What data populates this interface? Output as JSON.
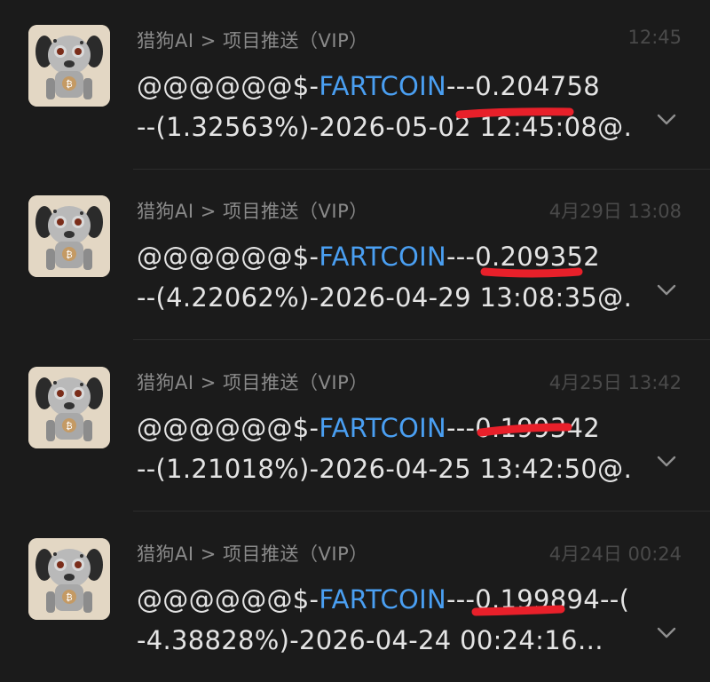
{
  "colors": {
    "background": "#1b1b1b",
    "sender": "#8a8a8a",
    "time": "#4a4a4a",
    "message": "#e4e4e4",
    "coin": "#4a9ff2",
    "annotation": "#e8202a"
  },
  "notifications": [
    {
      "sender": "猎狗AI > 项目推送（VIP）",
      "time": "12:45",
      "prefix": "@@@@@@$-",
      "coin": "FARTCOIN",
      "dashes": "---",
      "price": "0.204758",
      "line2": "--(1.32563%)-2026-05-02 12:45:08@…",
      "avatar_icon": "robot-dog-avatar",
      "expand_icon": "chevron-down-icon"
    },
    {
      "sender": "猎狗AI > 项目推送（VIP）",
      "time": "4月29日 13:08",
      "prefix": "@@@@@@$-",
      "coin": "FARTCOIN",
      "dashes": "---",
      "price": "0.209352",
      "line2": "--(4.22062%)-2026-04-29 13:08:35@…",
      "avatar_icon": "robot-dog-avatar",
      "expand_icon": "chevron-down-icon"
    },
    {
      "sender": "猎狗AI > 项目推送（VIP）",
      "time": "4月25日 13:42",
      "prefix": "@@@@@@$-",
      "coin": "FARTCOIN",
      "dashes": "---",
      "price": "0.199342",
      "line2": "--(1.21018%)-2026-04-25 13:42:50@…",
      "avatar_icon": "robot-dog-avatar",
      "expand_icon": "chevron-down-icon"
    },
    {
      "sender": "猎狗AI > 项目推送（VIP）",
      "time": "4月24日 00:24",
      "prefix": "@@@@@@$-",
      "coin": "FARTCOIN",
      "dashes": "---",
      "price": "0.199894",
      "suffix": "--(",
      "line2": "-4.38828%)-2026-04-24 00:24:16…",
      "avatar_icon": "robot-dog-avatar",
      "expand_icon": "chevron-down-icon"
    }
  ]
}
